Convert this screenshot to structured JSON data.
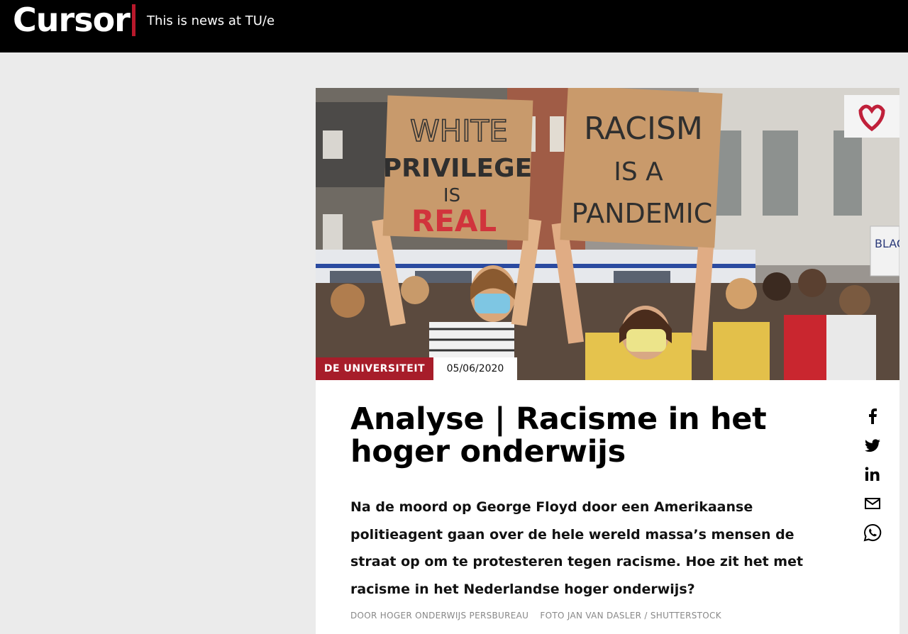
{
  "header": {
    "logo": "Cursor",
    "tagline": "This is news at TU/e"
  },
  "hero": {
    "sign_left": [
      "WHITE",
      "PRIVILEGE",
      "IS",
      "REAL"
    ],
    "sign_right": [
      "RACISM",
      "IS A",
      "PANDEMIC"
    ],
    "banner_text": "BLAC M"
  },
  "article": {
    "category": "DE UNIVERSITEIT",
    "date": "05/06/2020",
    "title": "Analyse | Racisme in het hoger onderwijs",
    "lead": "Na de moord op George Floyd door een Amerikaanse politieagent gaan over de hele wereld massa’s mensen de straat op om te protesteren tegen racisme. Hoe zit het met racisme in het Nederlandse hoger onderwijs?",
    "author": "DOOR HOGER ONDERWIJS PERSBUREAU",
    "photo_credit": "FOTO JAN VAN DASLER / SHUTTERSTOCK"
  },
  "share_icons": [
    "facebook-icon",
    "twitter-icon",
    "linkedin-icon",
    "mail-icon",
    "whatsapp-icon"
  ],
  "colors": {
    "accent": "#a71d2a",
    "header_bg": "#000000",
    "page_bg": "#ebebeb"
  }
}
